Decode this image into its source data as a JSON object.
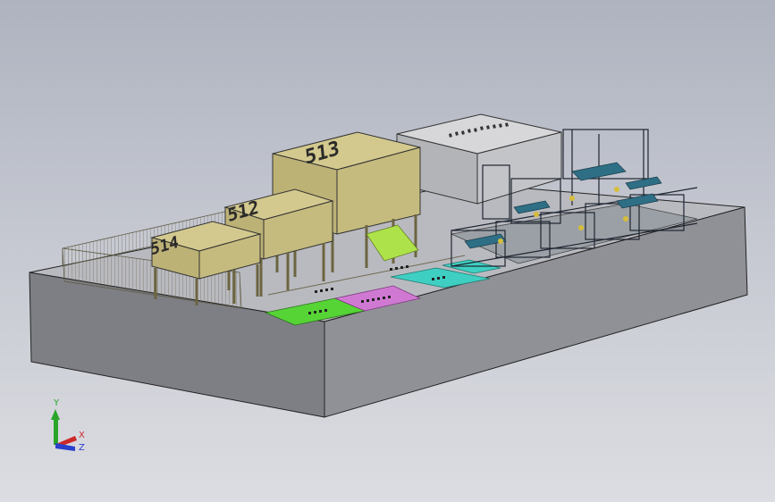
{
  "viewport": {
    "background_top": "#aeb3bf",
    "background_bottom": "#dcdde2"
  },
  "buildings": [
    {
      "label": "514",
      "color": "#c9bf86"
    },
    {
      "label": "512",
      "color": "#c9bf86"
    },
    {
      "label": "513",
      "color": "#c9bf86"
    }
  ],
  "zones": [
    {
      "color": "#56d436"
    },
    {
      "color": "#d079d2"
    },
    {
      "color": "#3fcfc2"
    },
    {
      "color": "#3fcfc2"
    }
  ],
  "triad": {
    "y_label": "Y",
    "x_label": "X",
    "z_label": "Z",
    "y_color": "#2aa52a",
    "x_color": "#cc2a2a",
    "z_color": "#2a3fcc"
  }
}
